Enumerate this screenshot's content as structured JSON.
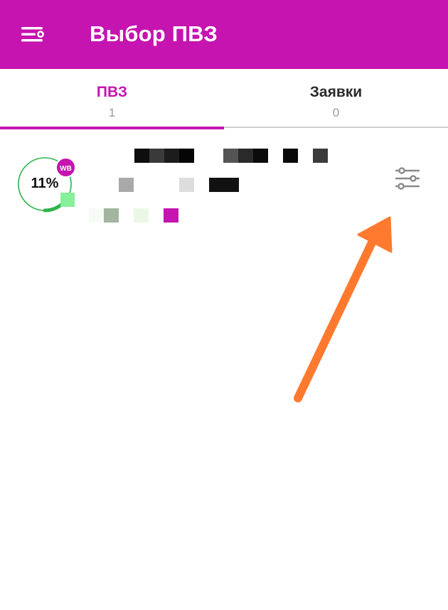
{
  "appbar": {
    "title": "Выбор ПВЗ",
    "menu_icon": "menu-settings-icon",
    "background": "#C514B0"
  },
  "tabs": [
    {
      "label": "ПВЗ",
      "count": "1",
      "active": true
    },
    {
      "label": "Заявки",
      "count": "0",
      "active": false
    }
  ],
  "list_item": {
    "progress_percent": 11,
    "progress_label": "11%",
    "badge": "WB",
    "progress_color": "#2DB34A"
  },
  "filter_icon": "sliders-icon",
  "accent_color": "#C514B0",
  "annotation_color": "#FF7A2F"
}
